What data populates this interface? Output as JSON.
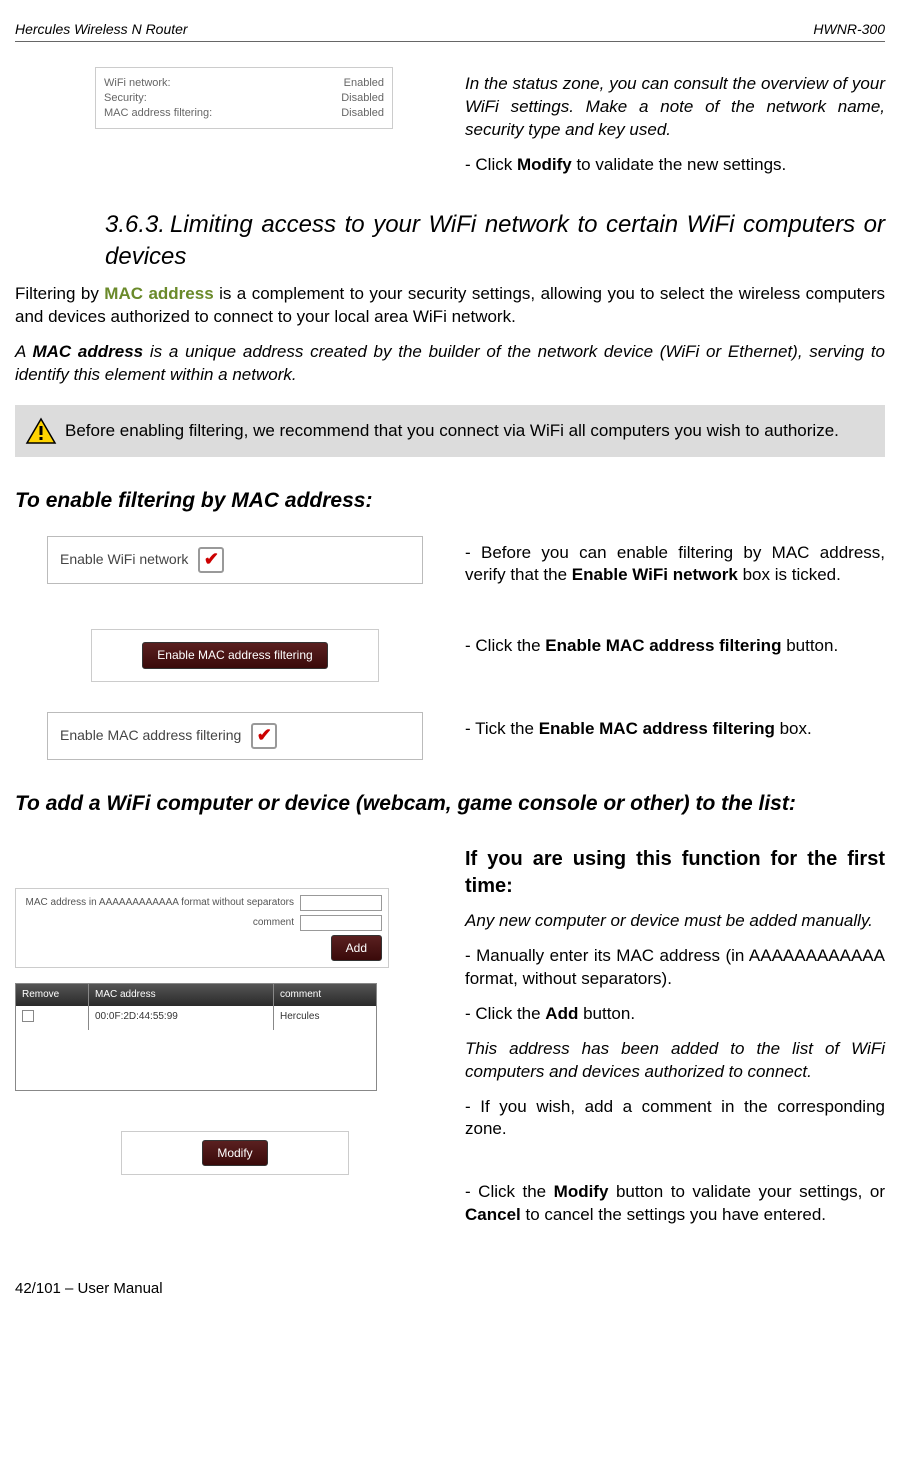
{
  "header": {
    "left": "Hercules Wireless N Router",
    "right": "HWNR-300"
  },
  "status_box": {
    "r1_label": "WiFi network:",
    "r1_value": "Enabled",
    "r2_label": "Security:",
    "r2_value": "Disabled",
    "r3_label": "MAC address filtering:",
    "r3_value": "Disabled"
  },
  "intro": {
    "p1": "In the status zone, you can consult the overview of your WiFi settings.  Make a note of the network name, security type and key used.",
    "p2a": "- Click ",
    "p2b": "Modify",
    "p2c": " to validate the new settings."
  },
  "section": {
    "num": "3.6.3.",
    "title": "Limiting access to your WiFi network to certain WiFi computers or devices"
  },
  "para1_a": "Filtering by ",
  "para1_link": "MAC address",
  "para1_b": " is a complement to your security settings, allowing you to select the wireless computers and devices authorized to connect to your local area WiFi network.",
  "para2_a": "A ",
  "para2_b": "MAC address",
  "para2_c": " is a unique address created by the builder of the network device (WiFi or Ethernet), serving to identify this element within a network.",
  "note": "Before enabling filtering, we recommend that you connect via WiFi all computers you wish to authorize.",
  "sub1": "To enable filtering by MAC address:",
  "enable_wifi_label": "Enable WiFi network",
  "step1_a": "- Before you can enable filtering by MAC address, verify that the ",
  "step1_b": "Enable WiFi network",
  "step1_c": " box is ticked.",
  "enable_mac_btn": "Enable MAC address filtering",
  "step2_a": "- Click the ",
  "step2_b": "Enable MAC address filtering",
  "step2_c": " button.",
  "enable_mac_label": "Enable MAC address filtering",
  "step3_a": "- Tick the ",
  "step3_b": "Enable MAC address filtering",
  "step3_c": " box.",
  "sub2": "To add a WiFi computer or device (webcam, game console or other) to the list:",
  "mac_form": {
    "label1": "MAC address in AAAAAAAAAAAA format without separators",
    "label2": "comment",
    "add_btn": "Add"
  },
  "mac_table": {
    "h1": "Remove",
    "h2": "MAC address",
    "h3": "comment",
    "r1c2": "00:0F:2D:44:55:99",
    "r1c3": "Hercules"
  },
  "modify_btn": "Modify",
  "first_time": {
    "heading": "If you are using this function for the first time:",
    "p1": "Any new computer or device must be added manually.",
    "p2": "- Manually enter its MAC address (in AAAAAAAAAAAA format, without separators).",
    "p3a": "- Click the ",
    "p3b": "Add",
    "p3c": " button.",
    "p4": "This address has been added to the list of WiFi computers and devices authorized to connect.",
    "p5": "- If you wish, add a comment in the corresponding zone.",
    "p6a": "- Click the ",
    "p6b": "Modify",
    "p6c": " button to validate your settings, or ",
    "p6d": "Cancel",
    "p6e": " to cancel the settings you have entered."
  },
  "footer": "42/101 – User Manual"
}
